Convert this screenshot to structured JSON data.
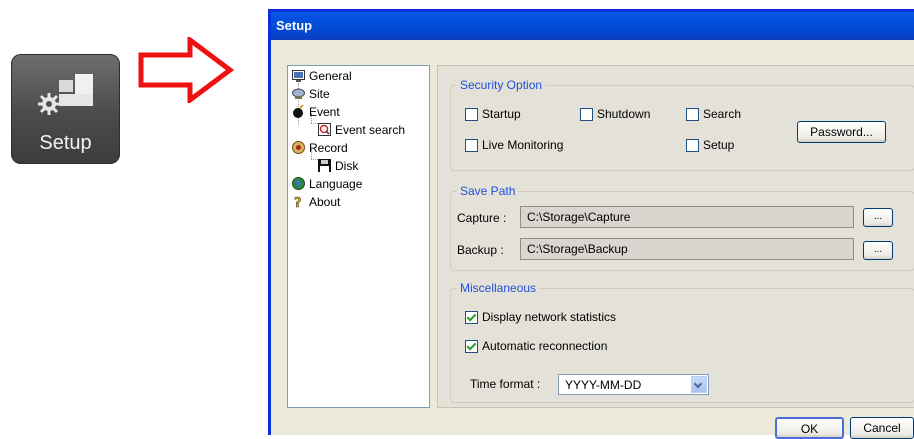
{
  "launcher": {
    "label": "Setup",
    "icon": "setup-gear-icon"
  },
  "window": {
    "title": "Setup"
  },
  "tree": [
    {
      "label": "General",
      "icon": "monitor-icon"
    },
    {
      "label": "Site",
      "icon": "site-icon"
    },
    {
      "label": "Event",
      "icon": "bomb-icon"
    },
    {
      "label": "Event search",
      "icon": "event-search-icon"
    },
    {
      "label": "Record",
      "icon": "record-icon"
    },
    {
      "label": "Disk",
      "icon": "floppy-disk-icon"
    },
    {
      "label": "Language",
      "icon": "globe-icon"
    },
    {
      "label": "About",
      "icon": "question-icon"
    }
  ],
  "security": {
    "title": "Security Option",
    "startup": "Startup",
    "shutdown": "Shutdown",
    "search": "Search",
    "live_monitoring": "Live Monitoring",
    "setup": "Setup",
    "password_button": "Password..."
  },
  "save_path": {
    "title": "Save Path",
    "capture_label": "Capture :",
    "capture_value": "C:\\Storage\\Capture",
    "backup_label": "Backup :",
    "backup_value": "C:\\Storage\\Backup",
    "browse_label": "..."
  },
  "misc": {
    "title": "Miscellaneous",
    "display_stats": "Display network statistics",
    "auto_reconnect": "Automatic reconnection",
    "time_format_label": "Time format :",
    "time_format_value": "YYYY-MM-DD"
  },
  "buttons": {
    "ok": "OK",
    "cancel": "Cancel"
  }
}
